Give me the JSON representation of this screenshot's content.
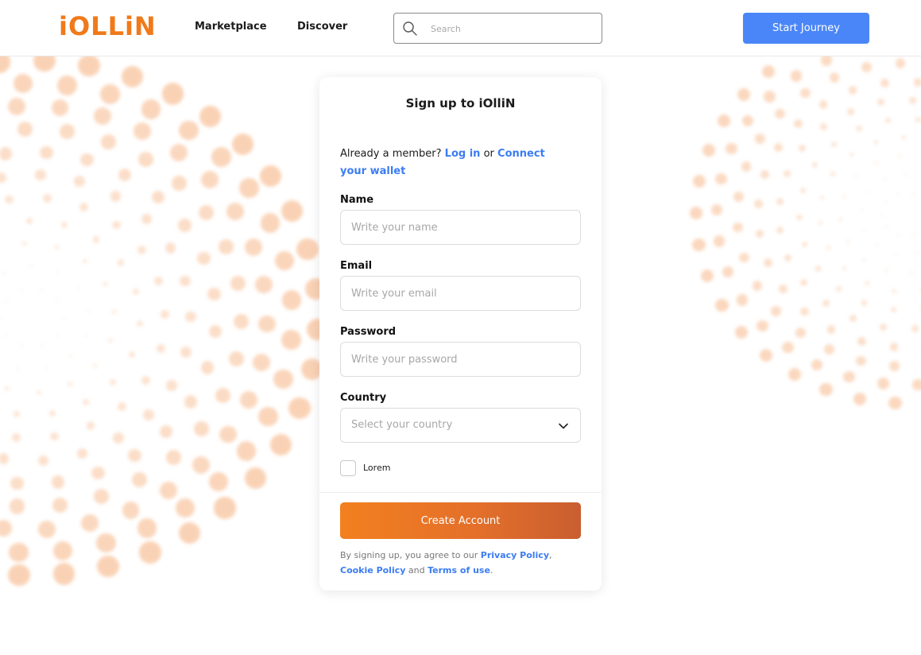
{
  "header": {
    "logo_text": "iOLLiN",
    "nav": [
      {
        "label": "Marketplace"
      },
      {
        "label": "Discover"
      }
    ],
    "search": {
      "placeholder": "Search"
    },
    "cta_label": "Start Journey"
  },
  "colors": {
    "brand_orange": "#f07a1a",
    "accent_blue": "#4a86f7",
    "link_blue": "#3b7cf2"
  },
  "card": {
    "title": "Sign up to iOlliN",
    "member_prefix": "Already a member?",
    "login_link": "Log in",
    "or_text": "or",
    "wallet_link": "Connect your wallet",
    "fields": {
      "name": {
        "label": "Name",
        "placeholder": "Write your name"
      },
      "email": {
        "label": "Email",
        "placeholder": "Write your email"
      },
      "password": {
        "label": "Password",
        "placeholder": "Write your password"
      },
      "country": {
        "label": "Country",
        "placeholder": "Select your country"
      }
    },
    "checkbox_label": "Lorem",
    "submit_label": "Create Account",
    "terms": {
      "prefix": "By signing up, you agree to our",
      "privacy": "Privacy Policy",
      "comma": ",",
      "cookie": "Cookie Policy",
      "and": "and",
      "tos": "Terms of use",
      "period": "."
    }
  }
}
